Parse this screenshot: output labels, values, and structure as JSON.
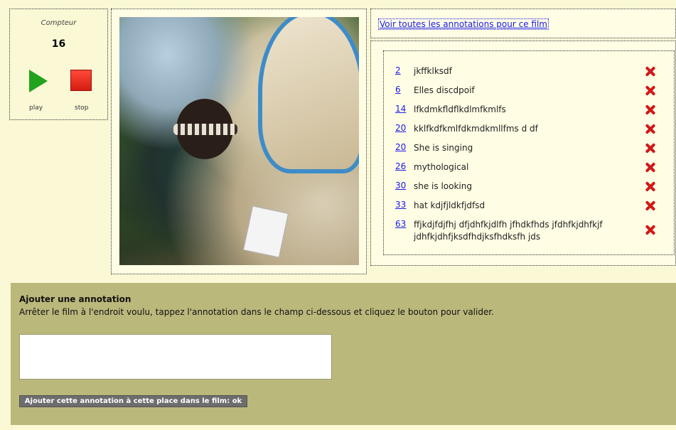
{
  "counter": {
    "label": "Compteur",
    "value": "16",
    "play_label": "play",
    "stop_label": "stop"
  },
  "all_annotations_link": "Voir toutes les annotations pour ce film",
  "annotations": [
    {
      "time": "2",
      "text": "jkffklksdf"
    },
    {
      "time": "6",
      "text": "Elles discdpoif"
    },
    {
      "time": "14",
      "text": "lfkdmkfldflkdlmfkmlfs"
    },
    {
      "time": "20",
      "text": "kklfkdfkmlfdkmdkmllfms d df"
    },
    {
      "time": "20",
      "text": "She is singing"
    },
    {
      "time": "26",
      "text": "mythological"
    },
    {
      "time": "30",
      "text": "she is looking"
    },
    {
      "time": "33",
      "text": "hat kdjfjldkfjdfsd"
    },
    {
      "time": "63",
      "text": "ffjkdjfdjfhj dfjdhfkjdlfh jfhdkfhds jfdhfkjdhfkjf jdhfkjdhfjksdfhdjksfhdksfh jds"
    }
  ],
  "add": {
    "title": "Ajouter une annotation",
    "help": "Arrêter le film à l'endroit voulu, tappez l'annotation dans le champ ci-dessous et cliquez le bouton pour valider.",
    "input_value": "",
    "button_label": "Ajouter cette annotation à cette place dans le film: ok"
  },
  "colors": {
    "background": "#fbf8d5",
    "add_section": "#bbb87c",
    "link": "#1a1aee",
    "delete": "#d01818",
    "play": "#22a31d",
    "stop": "#e02a1a"
  }
}
